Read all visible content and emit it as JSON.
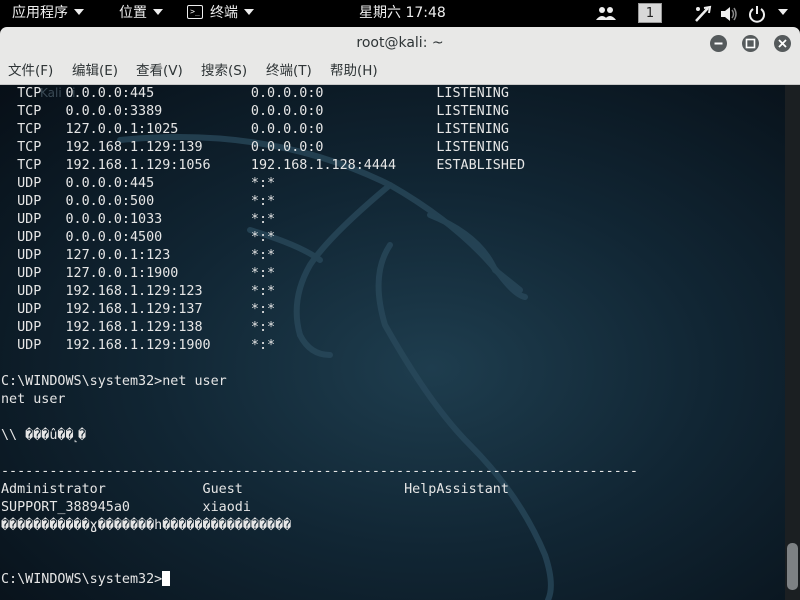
{
  "topbar": {
    "applications": "应用程序",
    "places": "位置",
    "app_menu": "终端",
    "clock": "星期六 17:48",
    "workspace": "1"
  },
  "window": {
    "title": "root@kali: ~"
  },
  "menu": [
    "文件(F)",
    "编辑(E)",
    "查看(V)",
    "搜索(S)",
    "终端(T)",
    "帮助(H)"
  ],
  "watermark": "Kali Li",
  "terminal": {
    "netstat_rows": [
      [
        "TCP",
        "0.0.0.0:445",
        "0.0.0.0:0",
        "LISTENING"
      ],
      [
        "TCP",
        "0.0.0.0:3389",
        "0.0.0.0:0",
        "LISTENING"
      ],
      [
        "TCP",
        "127.0.0.1:1025",
        "0.0.0.0:0",
        "LISTENING"
      ],
      [
        "TCP",
        "192.168.1.129:139",
        "0.0.0.0:0",
        "LISTENING"
      ],
      [
        "TCP",
        "192.168.1.129:1056",
        "192.168.1.128:4444",
        "ESTABLISHED"
      ],
      [
        "UDP",
        "0.0.0.0:445",
        "*:*",
        ""
      ],
      [
        "UDP",
        "0.0.0.0:500",
        "*:*",
        ""
      ],
      [
        "UDP",
        "0.0.0.0:1033",
        "*:*",
        ""
      ],
      [
        "UDP",
        "0.0.0.0:4500",
        "*:*",
        ""
      ],
      [
        "UDP",
        "127.0.0.1:123",
        "*:*",
        ""
      ],
      [
        "UDP",
        "127.0.0.1:1900",
        "*:*",
        ""
      ],
      [
        "UDP",
        "192.168.1.129:123",
        "*:*",
        ""
      ],
      [
        "UDP",
        "192.168.1.129:137",
        "*:*",
        ""
      ],
      [
        "UDP",
        "192.168.1.129:138",
        "*:*",
        ""
      ],
      [
        "UDP",
        "192.168.1.129:1900",
        "*:*",
        ""
      ]
    ],
    "blank1": "",
    "cmd_line": "C:\\WINDOWS\\system32>net user",
    "echo_line": "net user",
    "blank2": "",
    "user_header": "\\\\ ���û��˻�",
    "blank3": "",
    "separator": "-------------------------------------------------------------------------------",
    "users_row1": "Administrator            Guest                    HelpAssistant",
    "users_row2": "SUPPORT_388945a0         xiaodi",
    "garbled": "�����������ɣ�������һ����������������",
    "blank4": "",
    "blank5": "",
    "prompt": "C:\\WINDOWS\\system32>"
  },
  "icons": {
    "apps_triangle": "chevron-down-icon",
    "terminal_icon": "terminal-icon",
    "people_icon": "people-icon",
    "accessibility_icon": "accessibility-icon",
    "volume_icon": "volume-icon",
    "power_icon": "power-icon",
    "minimize": "minimize-icon",
    "maximize": "maximize-icon",
    "close": "close-icon"
  }
}
